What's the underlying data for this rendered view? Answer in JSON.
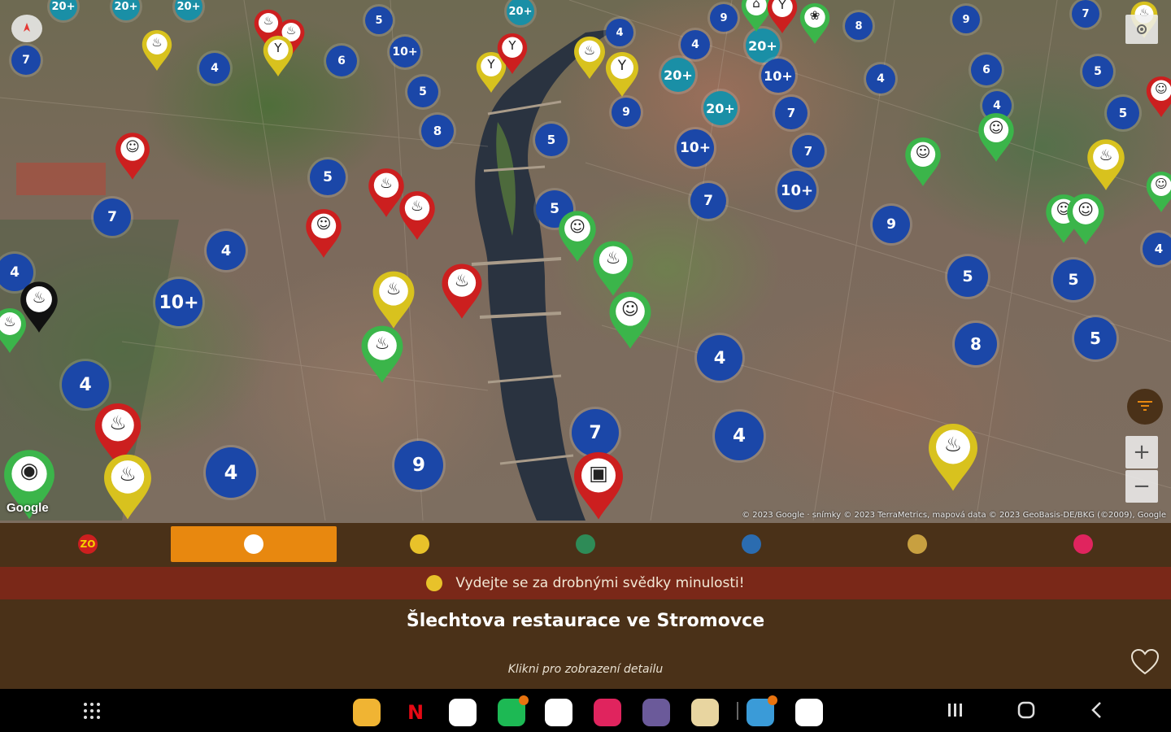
{
  "map": {
    "attribution": "© 2023 Google · snímky © 2023 TerraMetrics, mapová data © 2023 GeoBasis-DE/BKG (©2009), Google",
    "google_logo": "Google",
    "zoom_in": "+",
    "zoom_out": "−",
    "clusters": [
      {
        "label": "20+",
        "color": "teal"
      },
      {
        "label": "20+",
        "color": "teal"
      },
      {
        "label": "20+",
        "color": "teal"
      },
      {
        "label": "7",
        "color": "blue"
      },
      {
        "label": "4",
        "color": "blue"
      },
      {
        "label": "6",
        "color": "blue"
      },
      {
        "label": "5",
        "color": "blue"
      },
      {
        "label": "10+",
        "color": "blue"
      },
      {
        "label": "5",
        "color": "blue"
      },
      {
        "label": "8",
        "color": "blue"
      },
      {
        "label": "20+",
        "color": "teal"
      },
      {
        "label": "4",
        "color": "blue"
      },
      {
        "label": "9",
        "color": "blue"
      },
      {
        "label": "4",
        "color": "blue"
      },
      {
        "label": "20+",
        "color": "teal"
      },
      {
        "label": "10+",
        "color": "blue"
      },
      {
        "label": "20+",
        "color": "teal"
      },
      {
        "label": "9",
        "color": "blue"
      },
      {
        "label": "5",
        "color": "blue"
      },
      {
        "label": "20+",
        "color": "teal"
      },
      {
        "label": "7",
        "color": "blue"
      },
      {
        "label": "10+",
        "color": "blue"
      },
      {
        "label": "7",
        "color": "blue"
      },
      {
        "label": "10+",
        "color": "blue"
      },
      {
        "label": "7",
        "color": "blue"
      },
      {
        "label": "9",
        "color": "blue"
      },
      {
        "label": "4",
        "color": "blue"
      },
      {
        "label": "8",
        "color": "blue"
      },
      {
        "label": "9",
        "color": "blue"
      },
      {
        "label": "6",
        "color": "blue"
      },
      {
        "label": "7",
        "color": "blue"
      },
      {
        "label": "5",
        "color": "blue"
      },
      {
        "label": "4",
        "color": "blue"
      },
      {
        "label": "5",
        "color": "blue"
      },
      {
        "label": "5",
        "color": "blue"
      },
      {
        "label": "7",
        "color": "blue"
      },
      {
        "label": "4",
        "color": "blue"
      },
      {
        "label": "5",
        "color": "blue"
      },
      {
        "label": "10+",
        "color": "blue"
      },
      {
        "label": "4",
        "color": "blue"
      },
      {
        "label": "4",
        "color": "blue"
      },
      {
        "label": "5",
        "color": "blue"
      },
      {
        "label": "5",
        "color": "blue"
      },
      {
        "label": "4",
        "color": "blue"
      },
      {
        "label": "4",
        "color": "blue"
      },
      {
        "label": "5",
        "color": "blue"
      },
      {
        "label": "8",
        "color": "blue"
      },
      {
        "label": "7",
        "color": "blue"
      },
      {
        "label": "4",
        "color": "blue"
      },
      {
        "label": "9",
        "color": "blue"
      },
      {
        "label": "4",
        "color": "blue"
      }
    ],
    "pins": [
      {
        "color": "#d8c21e",
        "icon": "restaurant-icon"
      },
      {
        "color": "#cc1f1f",
        "icon": "restaurant-icon"
      },
      {
        "color": "#cc1f1f",
        "icon": "restaurant-icon"
      },
      {
        "color": "#d8c21e",
        "icon": "spring-icon"
      },
      {
        "color": "#d8c21e",
        "icon": "spring-icon"
      },
      {
        "color": "#cc1f1f",
        "icon": "spring-icon"
      },
      {
        "color": "#d8c21e",
        "icon": "restaurant-icon"
      },
      {
        "color": "#d8c21e",
        "icon": "spring-icon"
      },
      {
        "color": "#cc1f1f",
        "icon": "people-icon"
      },
      {
        "color": "#cc1f1f",
        "icon": "restaurant-icon"
      },
      {
        "color": "#cc1f1f",
        "icon": "restaurant-icon"
      },
      {
        "color": "#cc1f1f",
        "icon": "people-icon"
      },
      {
        "color": "#d8c21e",
        "icon": "restaurant-icon"
      },
      {
        "color": "#cc1f1f",
        "icon": "restaurant-icon"
      },
      {
        "color": "#3bb54a",
        "icon": "restaurant-icon"
      },
      {
        "color": "#3bb54a",
        "icon": "people-icon"
      },
      {
        "color": "#3bb54a",
        "icon": "restaurant-icon"
      },
      {
        "color": "#3bb54a",
        "icon": "people-icon"
      },
      {
        "color": "#111111",
        "icon": "restaurant-icon"
      },
      {
        "color": "#3bb54a",
        "icon": "restaurant-icon"
      },
      {
        "color": "#cc1f1f",
        "icon": "restaurant-icon"
      },
      {
        "color": "#d8c21e",
        "icon": "restaurant-icon"
      },
      {
        "color": "#3bb54a",
        "icon": "turtle-icon"
      },
      {
        "color": "#cc1f1f",
        "icon": "basket-icon"
      },
      {
        "color": "#3bb54a",
        "icon": "factory-icon"
      },
      {
        "color": "#cc1f1f",
        "icon": "spring-icon"
      },
      {
        "color": "#3bb54a",
        "icon": "bird-icon"
      },
      {
        "color": "#3bb54a",
        "icon": "people-icon"
      },
      {
        "color": "#3bb54a",
        "icon": "people-icon"
      },
      {
        "color": "#d8c21e",
        "icon": "restaurant-icon"
      },
      {
        "color": "#3bb54a",
        "icon": "people-icon"
      },
      {
        "color": "#3bb54a",
        "icon": "people-icon"
      },
      {
        "color": "#cc1f1f",
        "icon": "people-icon"
      },
      {
        "color": "#d8c21e",
        "icon": "restaurant-icon"
      },
      {
        "color": "#d8c21e",
        "icon": "restaurant-icon"
      },
      {
        "color": "#3bb54a",
        "icon": "people-icon"
      }
    ]
  },
  "tabs": [
    {
      "icon": "zo-icon",
      "text": "ZO",
      "bg": "#cc1f1f",
      "fg": "#f5d000"
    },
    {
      "icon": "restaurant-icon",
      "text": "",
      "bg": "#ffffff",
      "fg": "#333",
      "active": true
    },
    {
      "icon": "small-monuments-icon",
      "text": "",
      "bg": "#e8c22a",
      "fg": "#333"
    },
    {
      "icon": "tree-icon",
      "text": "",
      "bg": "#2e8b57",
      "fg": "#fff"
    },
    {
      "icon": "ship-icon",
      "text": "",
      "bg": "#2b6cb0",
      "fg": "#fff"
    },
    {
      "icon": "book-icon",
      "text": "",
      "bg": "#c8a040",
      "fg": "#333"
    },
    {
      "icon": "heart-icon",
      "text": "",
      "bg": "#e0245e",
      "fg": "#fff"
    }
  ],
  "banner": {
    "text": "Vydejte se za drobnými svědky minulosti!"
  },
  "detail": {
    "title": "Šlechtova restaurace ve Stromovce",
    "subtitle": "Klikni pro zobrazení detailu"
  },
  "taskbar": {
    "apps": [
      {
        "name": "files-app-icon",
        "color": "#f0b433"
      },
      {
        "name": "netflix-app-icon",
        "color": "#000000",
        "letter": "N"
      },
      {
        "name": "chrome-app-icon",
        "color": "#ffffff"
      },
      {
        "name": "spotify-app-icon",
        "color": "#1db954",
        "badge": true
      },
      {
        "name": "play-store-app-icon",
        "color": "#ffffff"
      },
      {
        "name": "camera-app-icon",
        "color": "#e0245e"
      },
      {
        "name": "grid-app-icon",
        "color": "#6b5a9a"
      },
      {
        "name": "map-app-icon",
        "color": "#e8d5a0"
      },
      {
        "name": "telegram-app-icon",
        "color": "#3a9bd8",
        "badge": true
      },
      {
        "name": "photos-app-icon",
        "color": "#ffffff"
      }
    ]
  }
}
